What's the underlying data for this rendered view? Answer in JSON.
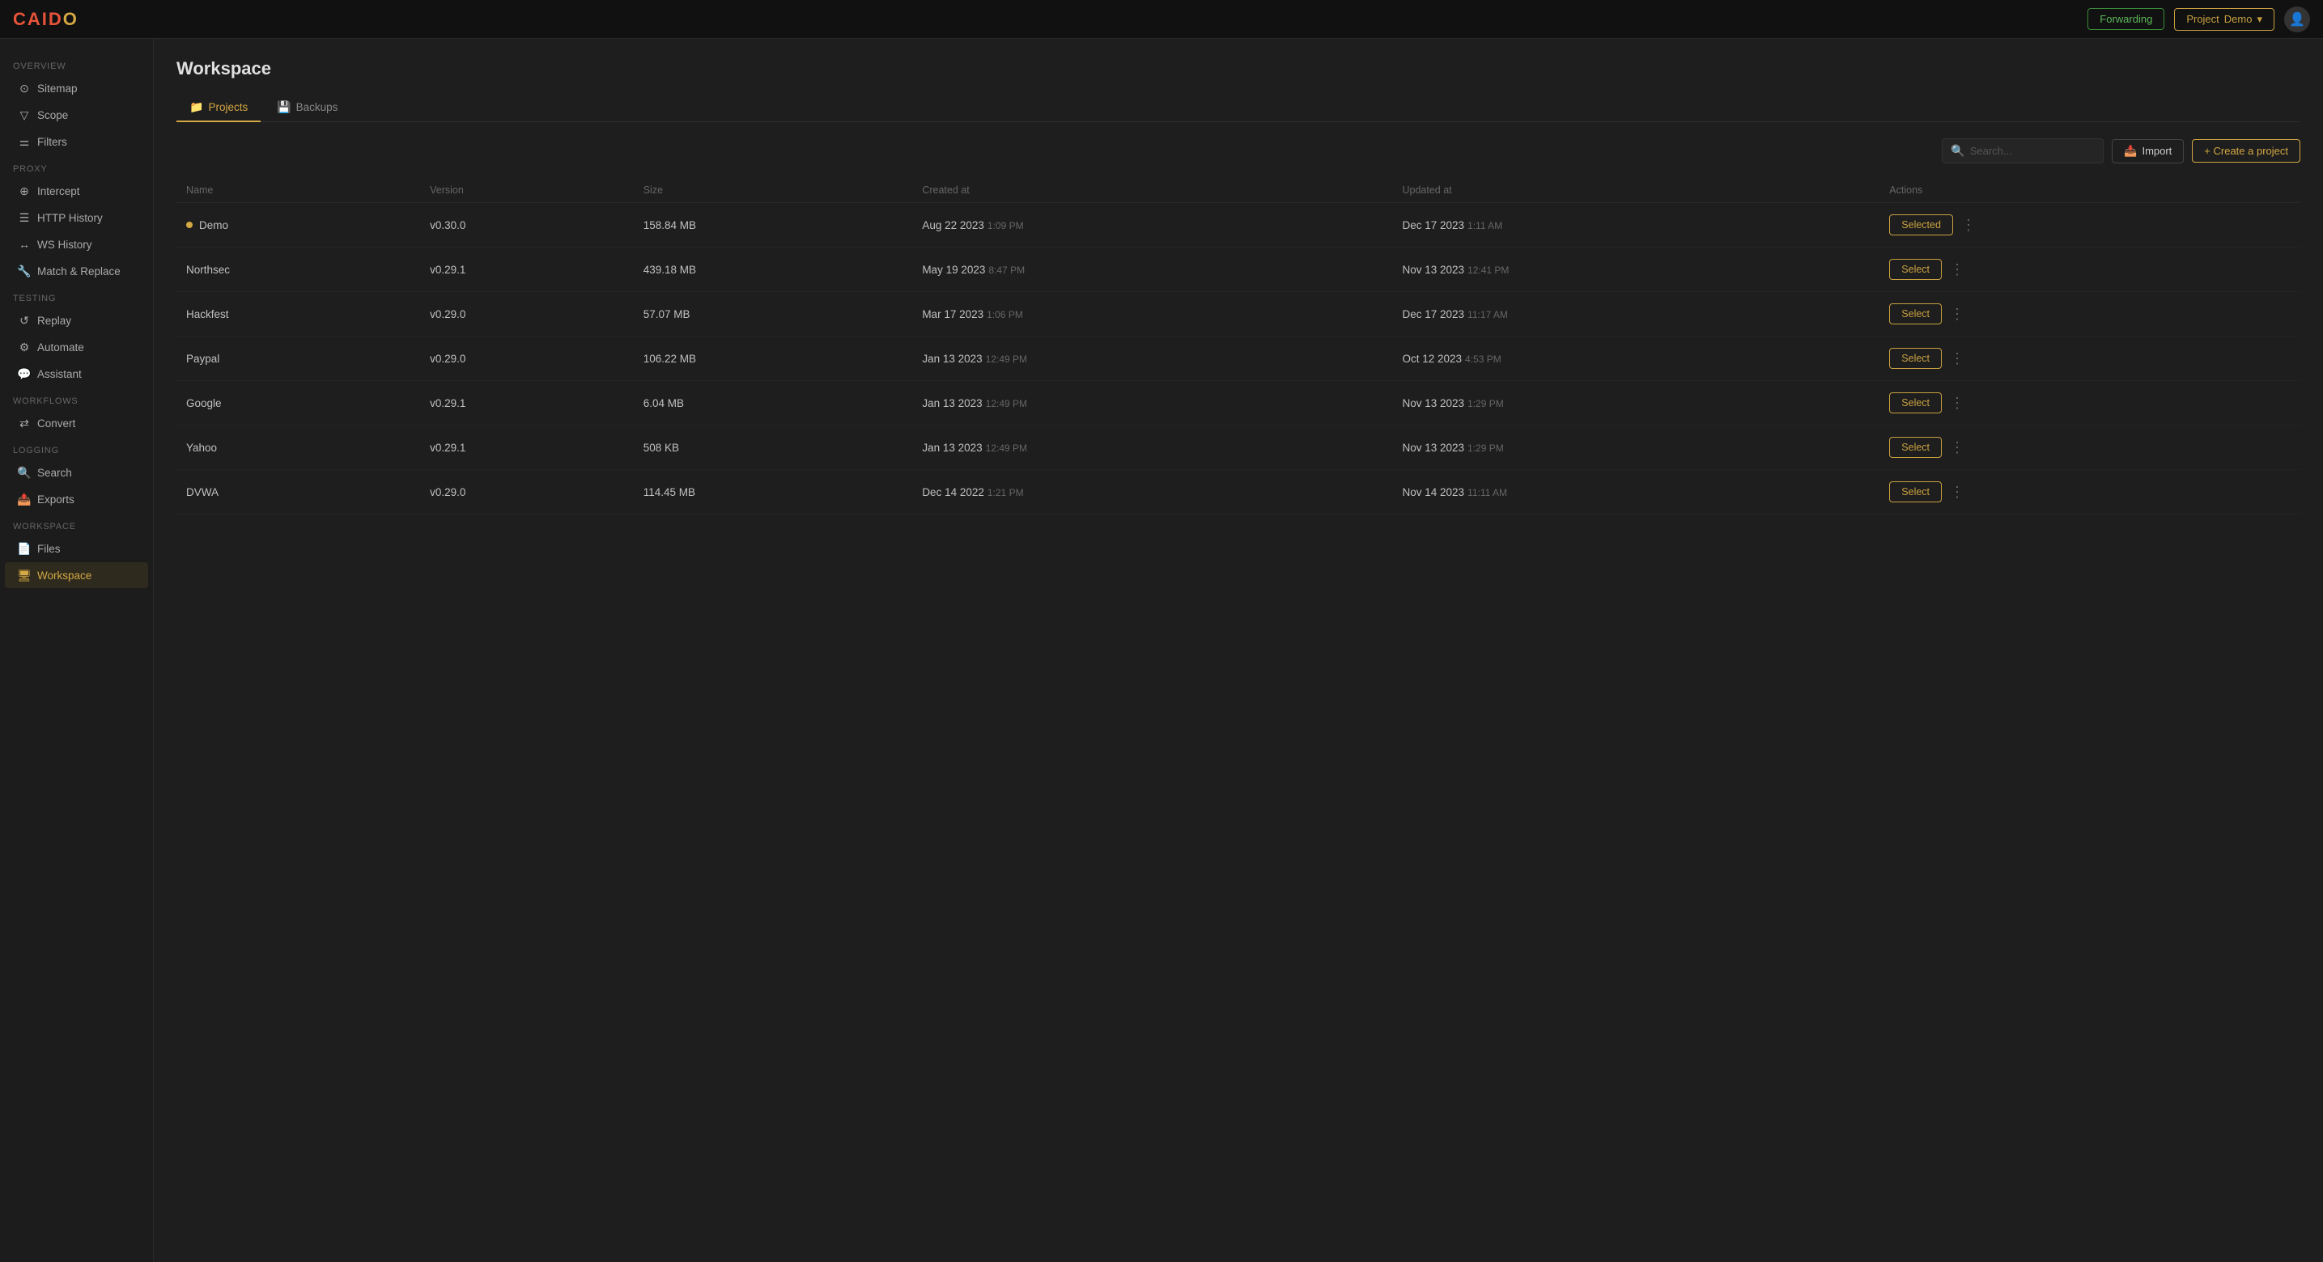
{
  "app": {
    "logo": "CAIDO"
  },
  "topbar": {
    "forwarding_label": "Forwarding",
    "project_label": "Project",
    "project_name": "Demo",
    "chevron": "▾"
  },
  "sidebar": {
    "sections": [
      {
        "label": "Overview",
        "items": [
          {
            "id": "sitemap",
            "icon": "⊙",
            "label": "Sitemap"
          },
          {
            "id": "scope",
            "icon": "▽",
            "label": "Scope"
          },
          {
            "id": "filters",
            "icon": "⚌",
            "label": "Filters"
          }
        ]
      },
      {
        "label": "Proxy",
        "items": [
          {
            "id": "intercept",
            "icon": "⊕",
            "label": "Intercept"
          },
          {
            "id": "http-history",
            "icon": "☰",
            "label": "HTTP History"
          },
          {
            "id": "ws-history",
            "icon": "↔",
            "label": "WS History"
          },
          {
            "id": "match-replace",
            "icon": "🔧",
            "label": "Match & Replace"
          }
        ]
      },
      {
        "label": "Testing",
        "items": [
          {
            "id": "replay",
            "icon": "↺",
            "label": "Replay"
          },
          {
            "id": "automate",
            "icon": "⚙",
            "label": "Automate"
          },
          {
            "id": "assistant",
            "icon": "💬",
            "label": "Assistant"
          }
        ]
      },
      {
        "label": "Workflows",
        "items": [
          {
            "id": "convert",
            "icon": "⇄",
            "label": "Convert"
          }
        ]
      },
      {
        "label": "Logging",
        "items": [
          {
            "id": "search",
            "icon": "🔍",
            "label": "Search"
          },
          {
            "id": "exports",
            "icon": "📤",
            "label": "Exports"
          }
        ]
      },
      {
        "label": "Workspace",
        "items": [
          {
            "id": "files",
            "icon": "📄",
            "label": "Files"
          },
          {
            "id": "workspace",
            "icon": "🖥",
            "label": "Workspace",
            "active": true
          }
        ]
      }
    ]
  },
  "page": {
    "title": "Workspace",
    "tabs": [
      {
        "id": "projects",
        "icon": "📁",
        "label": "Projects",
        "active": true
      },
      {
        "id": "backups",
        "icon": "💾",
        "label": "Backups"
      }
    ]
  },
  "toolbar": {
    "search_placeholder": "Search...",
    "import_label": "Import",
    "create_label": "+ Create a project"
  },
  "table": {
    "columns": [
      "Name",
      "Version",
      "Size",
      "Created at",
      "Updated at",
      "Actions"
    ],
    "rows": [
      {
        "name": "Demo",
        "active": true,
        "version": "v0.30.0",
        "size": "158.84 MB",
        "created_date": "Aug 22 2023",
        "created_time": "1:09 PM",
        "updated_date": "Dec 17 2023",
        "updated_time": "1:11 AM",
        "action": "Selected",
        "is_selected": true
      },
      {
        "name": "Northsec",
        "active": false,
        "version": "v0.29.1",
        "size": "439.18 MB",
        "created_date": "May 19 2023",
        "created_time": "8:47 PM",
        "updated_date": "Nov 13 2023",
        "updated_time": "12:41 PM",
        "action": "Select",
        "is_selected": false
      },
      {
        "name": "Hackfest",
        "active": false,
        "version": "v0.29.0",
        "size": "57.07 MB",
        "created_date": "Mar 17 2023",
        "created_time": "1:06 PM",
        "updated_date": "Dec 17 2023",
        "updated_time": "11:17 AM",
        "action": "Select",
        "is_selected": false
      },
      {
        "name": "Paypal",
        "active": false,
        "version": "v0.29.0",
        "size": "106.22 MB",
        "created_date": "Jan 13 2023",
        "created_time": "12:49 PM",
        "updated_date": "Oct 12 2023",
        "updated_time": "4:53 PM",
        "action": "Select",
        "is_selected": false
      },
      {
        "name": "Google",
        "active": false,
        "version": "v0.29.1",
        "size": "6.04 MB",
        "created_date": "Jan 13 2023",
        "created_time": "12:49 PM",
        "updated_date": "Nov 13 2023",
        "updated_time": "1:29 PM",
        "action": "Select",
        "is_selected": false
      },
      {
        "name": "Yahoo",
        "active": false,
        "version": "v0.29.1",
        "size": "508 KB",
        "created_date": "Jan 13 2023",
        "created_time": "12:49 PM",
        "updated_date": "Nov 13 2023",
        "updated_time": "1:29 PM",
        "action": "Select",
        "is_selected": false
      },
      {
        "name": "DVWA",
        "active": false,
        "version": "v0.29.0",
        "size": "114.45 MB",
        "created_date": "Dec 14 2022",
        "created_time": "1:21 PM",
        "updated_date": "Nov 14 2023",
        "updated_time": "11:11 AM",
        "action": "Select",
        "is_selected": false
      }
    ]
  }
}
